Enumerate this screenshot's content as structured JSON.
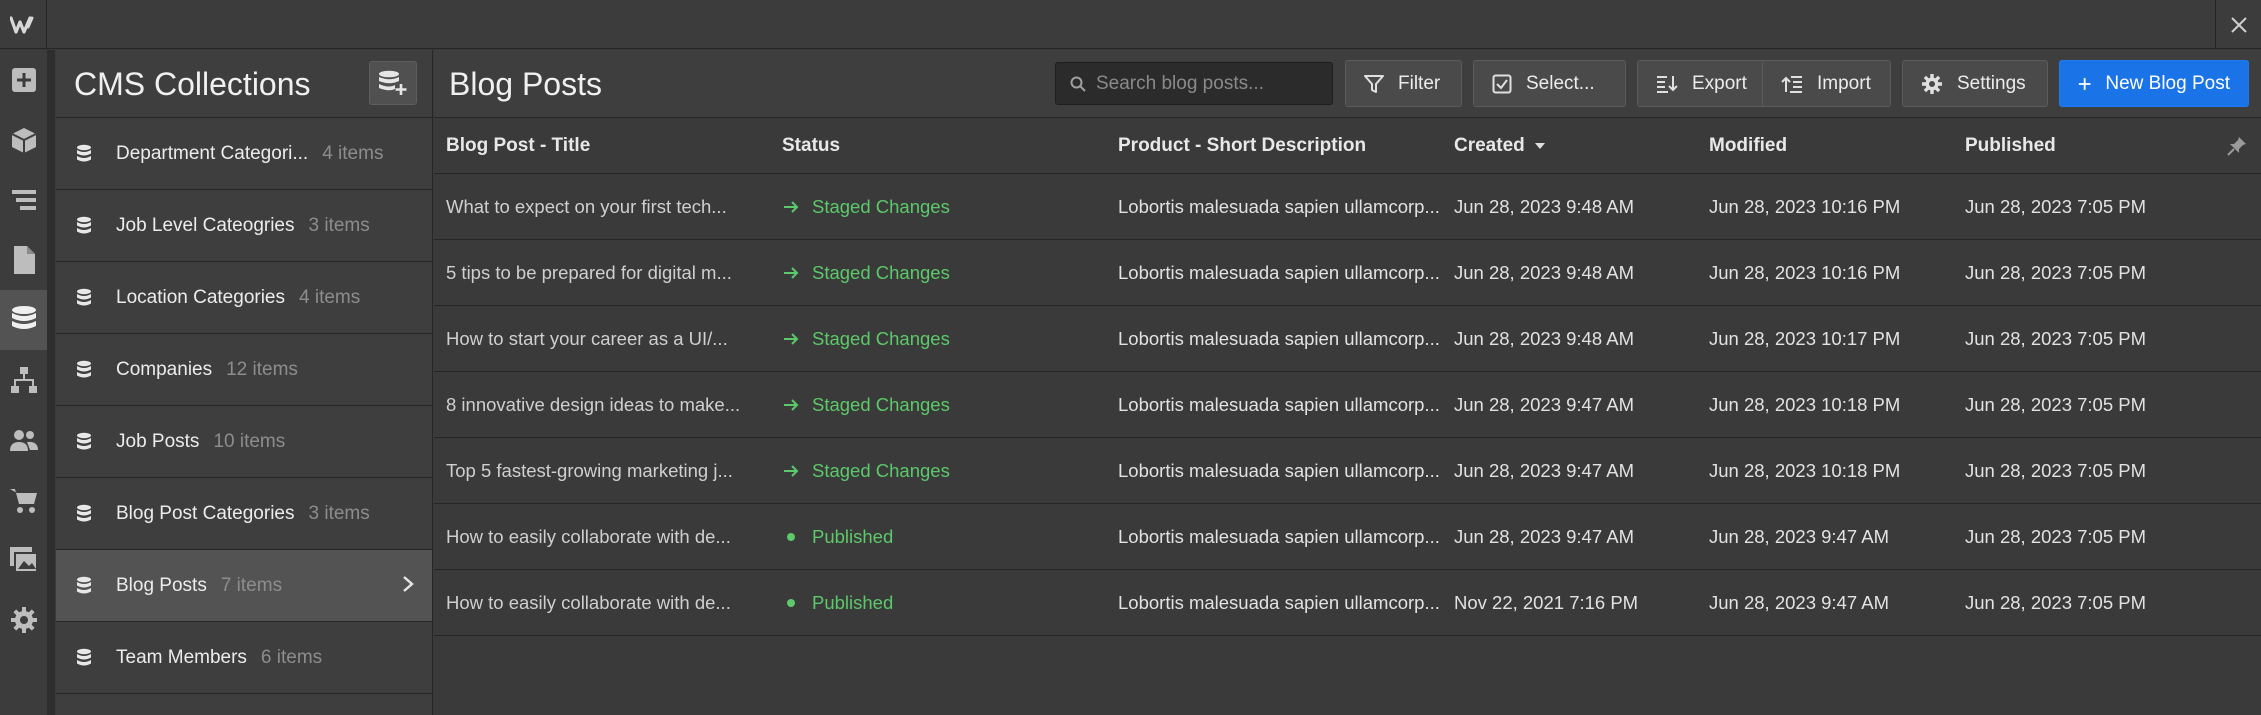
{
  "topbar": {
    "logo": "W",
    "logo_icon": "webflow-logo-icon",
    "close_icon": "close-icon"
  },
  "rail": [
    {
      "icon": "add-icon",
      "label": "Add"
    },
    {
      "icon": "cube-icon",
      "label": "Symbols"
    },
    {
      "icon": "navigator-icon",
      "label": "Navigator"
    },
    {
      "icon": "pages-icon",
      "label": "Pages"
    },
    {
      "icon": "database-icon",
      "label": "CMS",
      "active": true
    },
    {
      "icon": "flow-icon",
      "label": "Logic"
    },
    {
      "icon": "users-icon",
      "label": "Users"
    },
    {
      "icon": "cart-icon",
      "label": "Ecommerce"
    },
    {
      "icon": "assets-icon",
      "label": "Assets"
    },
    {
      "icon": "gear-icon",
      "label": "Settings"
    }
  ],
  "collections": {
    "title": "CMS Collections",
    "add_icon": "add-collection-icon",
    "items": [
      {
        "name": "Department Categori...",
        "count": "4 items"
      },
      {
        "name": "Job Level Cateogries",
        "count": "3 items"
      },
      {
        "name": "Location Categories",
        "count": "4 items"
      },
      {
        "name": "Companies",
        "count": "12 items"
      },
      {
        "name": "Job Posts",
        "count": "10 items"
      },
      {
        "name": "Blog Post Categories",
        "count": "3 items"
      },
      {
        "name": "Blog Posts",
        "count": "7 items",
        "active": true
      },
      {
        "name": "Team Members",
        "count": "6 items"
      }
    ]
  },
  "main": {
    "title": "Blog Posts",
    "search_placeholder": "Search blog posts...",
    "buttons": {
      "filter": "Filter",
      "select": "Select...",
      "export": "Export",
      "import": "Import",
      "settings": "Settings",
      "new": "New Blog Post"
    }
  },
  "table": {
    "columns": [
      "Blog Post - Title",
      "Status",
      "Product - Short Description",
      "Created",
      "Modified",
      "Published"
    ],
    "sort_column": "Created",
    "rows": [
      {
        "title": "What to expect on your first tech...",
        "status": "Staged Changes",
        "desc": "Lobortis malesuada sapien ullamcorp...",
        "created": "Jun 28, 2023 9:48 AM",
        "modified": "Jun 28, 2023 10:16 PM",
        "published": "Jun 28, 2023 7:05 PM"
      },
      {
        "title": "5 tips to be prepared for digital m...",
        "status": "Staged Changes",
        "desc": "Lobortis malesuada sapien ullamcorp...",
        "created": "Jun 28, 2023 9:48 AM",
        "modified": "Jun 28, 2023 10:16 PM",
        "published": "Jun 28, 2023 7:05 PM"
      },
      {
        "title": "How to start your career as a UI/...",
        "status": "Staged Changes",
        "desc": "Lobortis malesuada sapien ullamcorp...",
        "created": "Jun 28, 2023 9:48 AM",
        "modified": "Jun 28, 2023 10:17 PM",
        "published": "Jun 28, 2023 7:05 PM"
      },
      {
        "title": "8 innovative design ideas to make...",
        "status": "Staged Changes",
        "desc": "Lobortis malesuada sapien ullamcorp...",
        "created": "Jun 28, 2023 9:47 AM",
        "modified": "Jun 28, 2023 10:18 PM",
        "published": "Jun 28, 2023 7:05 PM"
      },
      {
        "title": "Top 5 fastest-growing marketing j...",
        "status": "Staged Changes",
        "desc": "Lobortis malesuada sapien ullamcorp...",
        "created": "Jun 28, 2023 9:47 AM",
        "modified": "Jun 28, 2023 10:18 PM",
        "published": "Jun 28, 2023 7:05 PM"
      },
      {
        "title": "How to easily collaborate with de...",
        "status": "Published",
        "desc": "Lobortis malesuada sapien ullamcorp...",
        "created": "Jun 28, 2023 9:47 AM",
        "modified": "Jun 28, 2023 9:47 AM",
        "published": "Jun 28, 2023 7:05 PM"
      },
      {
        "title": "How to easily collaborate with de...",
        "status": "Published",
        "desc": "Lobortis malesuada sapien ullamcorp...",
        "created": "Nov 22, 2021 7:16 PM",
        "modified": "Jun 28, 2023 9:47 AM",
        "published": "Jun 28, 2023 7:05 PM"
      }
    ]
  },
  "colors": {
    "accent": "#1a74e8",
    "status_green": "#5cc96a",
    "background": "#3a3a3a"
  }
}
